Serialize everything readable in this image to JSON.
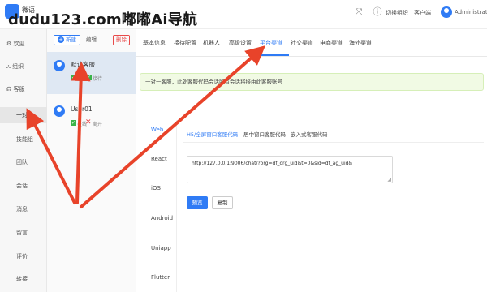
{
  "app": {
    "title": "微语"
  },
  "watermark": {
    "text": "dudu123.com嘟嘟Ai导航"
  },
  "header": {
    "expand_icon": "expand-icon",
    "switch_org": "切换组织",
    "client": "客户端",
    "user": "Administrator"
  },
  "leftnav": {
    "items": [
      {
        "label": "欢迎",
        "icon": "gear-icon"
      },
      {
        "label": "组织",
        "icon": "org-icon"
      },
      {
        "label": "客服",
        "icon": "headset-icon"
      },
      {
        "label": "一对一"
      },
      {
        "label": "技能组"
      },
      {
        "label": "团队"
      },
      {
        "label": "会话"
      },
      {
        "label": "消息"
      },
      {
        "label": "留言"
      },
      {
        "label": "评价"
      },
      {
        "label": "转接"
      }
    ]
  },
  "contacts": {
    "new_label": "新建",
    "edit_label": "编辑",
    "delete_label": "删除",
    "items": [
      {
        "name": "默认客服",
        "tag1": "在线",
        "tag2": "接待"
      },
      {
        "name": "User01",
        "tag1": "在线",
        "tag2": "离开"
      }
    ]
  },
  "main": {
    "tabs": [
      "基本信息",
      "接待配置",
      "机器人",
      "高级设置",
      "平台渠道",
      "社交渠道",
      "电商渠道",
      "海外渠道"
    ],
    "active_tab": "平台渠道",
    "notice": "一对一客服，此处客服代码会话所有会话将接由此客服账号",
    "platforms": [
      "Web",
      "React",
      "iOS",
      "Android",
      "Uniapp",
      "Flutter"
    ],
    "subtabs": [
      "H5/全屏窗口客服代码",
      "居中窗口客服代码",
      "嵌入式客服代码"
    ],
    "code": "http://127.0.0.1:9006/chat/?org=df_org_uid&t=0&sid=df_ag_uid&",
    "preview_label": "预览",
    "copy_label": "复制"
  },
  "colors": {
    "accent": "#2f7bf5",
    "arrow": "#e8432a",
    "notice_bg": "#f1fae4"
  }
}
